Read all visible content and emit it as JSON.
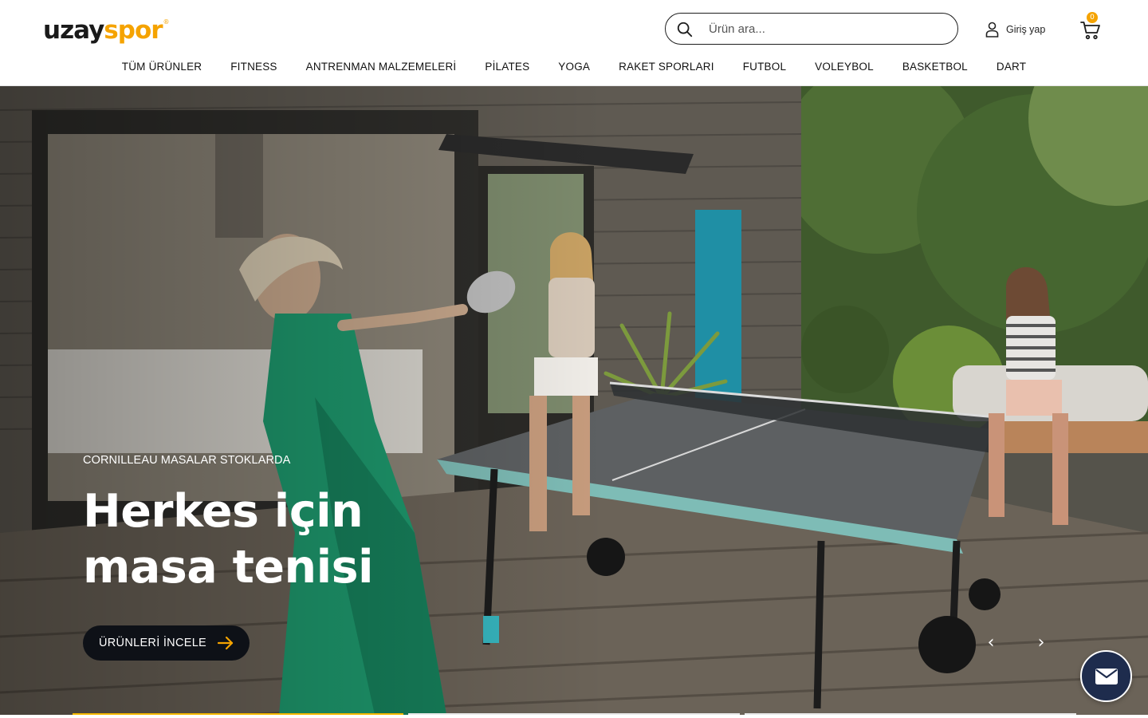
{
  "brand": {
    "name_part_a": "uzay",
    "name_part_b": "spor",
    "registered_mark": "®",
    "accent_color": "#f5a300"
  },
  "search": {
    "placeholder": "Ürün ara..."
  },
  "account": {
    "login_label": "Giriş yap"
  },
  "cart": {
    "count": "0"
  },
  "nav": {
    "items": [
      {
        "label": "TÜM ÜRÜNLER"
      },
      {
        "label": "FITNESS"
      },
      {
        "label": "ANTRENMAN MALZEMELERİ"
      },
      {
        "label": "PİLATES"
      },
      {
        "label": "YOGA"
      },
      {
        "label": "RAKET SPORLARI"
      },
      {
        "label": "FUTBOL"
      },
      {
        "label": "VOLEYBOL"
      },
      {
        "label": "BASKETBOL"
      },
      {
        "label": "DART"
      }
    ]
  },
  "hero": {
    "eyebrow": "CORNILLEAU MASALAR STOKLARDA",
    "headline_line1": "Herkes için",
    "headline_line2": "masa tenisi",
    "cta_label": "ÜRÜNLERİ İNCELE",
    "prev_icon": "chevron-left-icon",
    "next_icon": "chevron-right-icon",
    "slides_total": 3,
    "active_slide": 1,
    "progress_colors": {
      "active": "#f5b800",
      "inactive": "#e9e9e9"
    }
  },
  "chat": {
    "icon": "mail-icon",
    "bg_color": "#1e2c4d"
  }
}
